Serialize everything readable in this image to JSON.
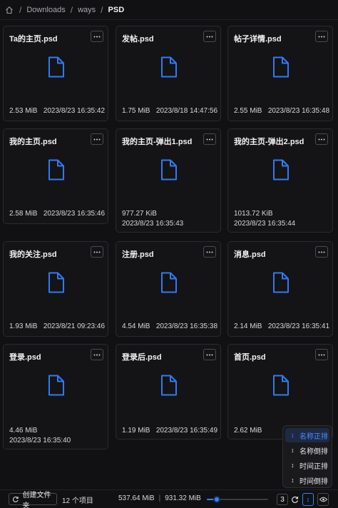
{
  "breadcrumb": {
    "separator": "/",
    "items": [
      "Downloads",
      "ways"
    ],
    "current": "PSD"
  },
  "files": [
    {
      "name": "Ta的主页.psd",
      "size": "2.53 MiB",
      "date": "2023/8/23 16:35:42"
    },
    {
      "name": "发帖.psd",
      "size": "1.75 MiB",
      "date": "2023/8/18 14:47:56"
    },
    {
      "name": "帖子详情.psd",
      "size": "2.55 MiB",
      "date": "2023/8/23 16:35:48"
    },
    {
      "name": "我的主页.psd",
      "size": "2.58 MiB",
      "date": "2023/8/23 16:35:46"
    },
    {
      "name": "我的主页-弹出1.psd",
      "size": "977.27 KiB",
      "date": "2023/8/23 16:35:43"
    },
    {
      "name": "我的主页-弹出2.psd",
      "size": "1013.72 KiB",
      "date": "2023/8/23 16:35:44"
    },
    {
      "name": "我的关注.psd",
      "size": "1.93 MiB",
      "date": "2023/8/21 09:23:46"
    },
    {
      "name": "注册.psd",
      "size": "4.54 MiB",
      "date": "2023/8/23 16:35:38"
    },
    {
      "name": "消息.psd",
      "size": "2.14 MiB",
      "date": "2023/8/23 16:35:41"
    },
    {
      "name": "登录.psd",
      "size": "4.46 MiB",
      "date": "2023/8/23 16:35:40"
    },
    {
      "name": "登录后.psd",
      "size": "1.19 MiB",
      "date": "2023/8/23 16:35:49"
    },
    {
      "name": "首页.psd",
      "size": "2.62 MiB",
      "date": ""
    }
  ],
  "sort_menu": {
    "items": [
      {
        "glyph": "↕",
        "label": "名称正排"
      },
      {
        "glyph": "↕",
        "label": "名称倒排"
      },
      {
        "glyph": "↕",
        "label": "时间正排"
      },
      {
        "glyph": "↕",
        "label": "时间倒排"
      }
    ]
  },
  "statusbar": {
    "create_folder": "创建文件夹",
    "item_count": "12 个项目",
    "disk_free": "537.64 MiB",
    "disk_sep": "|",
    "disk_total": "931.32 MiB",
    "columns": "3",
    "zoom": 0.16,
    "sort_glyph": "↕"
  },
  "icons": {
    "home": "home-icon",
    "file": "file-icon",
    "more": "ellipsis-icon",
    "refresh": "refresh-icon",
    "eye": "eye-icon"
  },
  "colors": {
    "accent": "#3b82f6",
    "file_icon": "#2f7bf5",
    "background": "#111113",
    "card_border": "#2b2b30"
  }
}
